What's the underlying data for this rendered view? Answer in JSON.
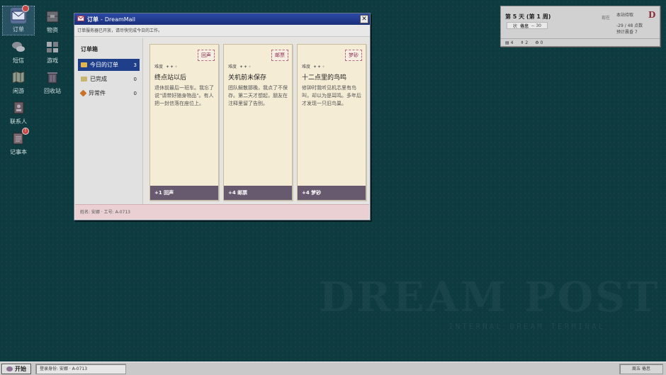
{
  "desktop": {
    "icons": [
      {
        "label": "订单",
        "icon": "mail-inbox-icon",
        "badge": ""
      },
      {
        "label": "物资",
        "icon": "crate-icon",
        "badge": ""
      },
      {
        "label": "短信",
        "icon": "chat-bubbles-icon",
        "badge": ""
      },
      {
        "label": "游戏",
        "icon": "game-tiles-icon",
        "badge": ""
      },
      {
        "label": "闲游",
        "icon": "map-icon",
        "badge": ""
      },
      {
        "label": "回收站",
        "icon": "recycle-bin-icon",
        "badge": ""
      },
      {
        "label": "联系人",
        "icon": "contacts-book-icon",
        "badge": ""
      },
      {
        "label": "记事本",
        "icon": "notebook-icon",
        "badge": "!"
      }
    ],
    "watermark_title": "DREAM POST",
    "watermark_subtitle": "INTERNAL DREAM TERMINAL"
  },
  "status_widget": {
    "day": "第 5 天 (第 1 周)",
    "mood_label": "状",
    "mood_value": "倦怠",
    "mood_extra": "-- 30",
    "now_label": "现在",
    "location": "本站待取",
    "progress": "-29 / 48 点数",
    "eta": "预计晨昏 7",
    "logo": "D",
    "stats": [
      {
        "icon": "mail-stack-icon",
        "value": "4"
      },
      {
        "icon": "bottle-icon",
        "value": "2"
      },
      {
        "icon": "trash-icon",
        "value": "0"
      }
    ]
  },
  "window": {
    "title_app": "订单",
    "title_sep": "-",
    "title_name": "DreamMail",
    "close_label": "✕",
    "notice": "订单服务器已开放，请尽快完成今日的工作。",
    "sidebar": {
      "heading": "订单箱",
      "folders": [
        {
          "label": "今日的订单",
          "count": "3",
          "active": true,
          "color": "#e2b64a"
        },
        {
          "label": "已完成",
          "count": "0",
          "active": false,
          "color": "#c9b470"
        },
        {
          "label": "异常件",
          "count": "0",
          "active": false,
          "color": "#c8722a"
        }
      ]
    },
    "cards": [
      {
        "stamp": "回声",
        "difficulty_label": "难度",
        "pips_on": 2,
        "pips_total": 3,
        "title": "终点站以后",
        "description": "退休前最后一班车。我忘了说\"请带好随身物品\"。有人把一封信落在座位上。",
        "reward": "+1 回声"
      },
      {
        "stamp": "邮票",
        "difficulty_label": "难度",
        "pips_on": 2,
        "pips_total": 3,
        "title": "关机前未保存",
        "description": "团队解散那晚，我点了不保存。第二天才想起，朋友在注释里留了告别。",
        "reward": "+4 邮票"
      },
      {
        "stamp": "梦砂",
        "difficulty_label": "难度",
        "pips_on": 2,
        "pips_total": 3,
        "title": "十二点里的鸟鸣",
        "description": "修钟时我听见机芯里有鸟叫，却以为是耳鸣。多年后才发现一只旧鸟巢。",
        "reward": "+4 梦砂"
      }
    ],
    "footer": "姓名: 安娜 · 工号: A-0713"
  },
  "taskbar": {
    "start_label": "开始",
    "login_info": "登录身份: 安娜 · A-0713",
    "right_info": "周五 倦怠"
  },
  "colors": {
    "desktop_bg": "#0e3b40",
    "titlebar": "#1f3f8b",
    "card_bg": "#f5ecd5",
    "reward_bar": "#675a6e",
    "stamp": "#8a2d52"
  }
}
